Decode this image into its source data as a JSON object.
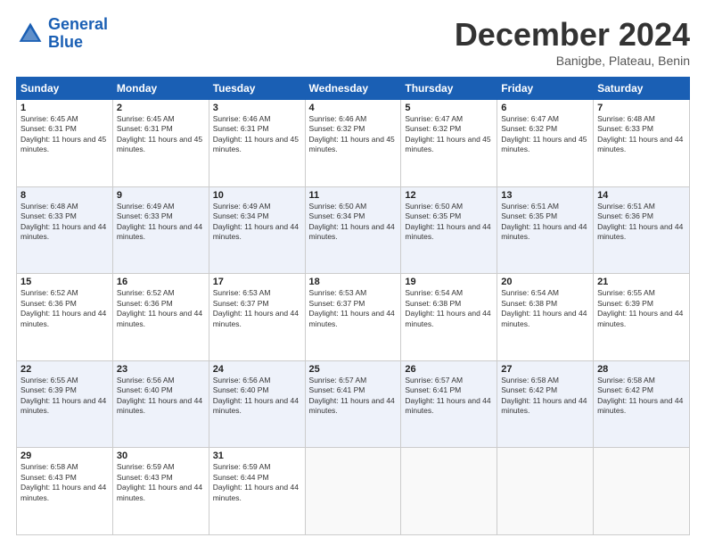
{
  "header": {
    "logo_line1": "General",
    "logo_line2": "Blue",
    "month": "December 2024",
    "location": "Banigbe, Plateau, Benin"
  },
  "days_of_week": [
    "Sunday",
    "Monday",
    "Tuesday",
    "Wednesday",
    "Thursday",
    "Friday",
    "Saturday"
  ],
  "weeks": [
    [
      {
        "day": 1,
        "sunrise": "6:45 AM",
        "sunset": "6:31 PM",
        "daylight": "11 hours and 45 minutes."
      },
      {
        "day": 2,
        "sunrise": "6:45 AM",
        "sunset": "6:31 PM",
        "daylight": "11 hours and 45 minutes."
      },
      {
        "day": 3,
        "sunrise": "6:46 AM",
        "sunset": "6:31 PM",
        "daylight": "11 hours and 45 minutes."
      },
      {
        "day": 4,
        "sunrise": "6:46 AM",
        "sunset": "6:32 PM",
        "daylight": "11 hours and 45 minutes."
      },
      {
        "day": 5,
        "sunrise": "6:47 AM",
        "sunset": "6:32 PM",
        "daylight": "11 hours and 45 minutes."
      },
      {
        "day": 6,
        "sunrise": "6:47 AM",
        "sunset": "6:32 PM",
        "daylight": "11 hours and 45 minutes."
      },
      {
        "day": 7,
        "sunrise": "6:48 AM",
        "sunset": "6:33 PM",
        "daylight": "11 hours and 44 minutes."
      }
    ],
    [
      {
        "day": 8,
        "sunrise": "6:48 AM",
        "sunset": "6:33 PM",
        "daylight": "11 hours and 44 minutes."
      },
      {
        "day": 9,
        "sunrise": "6:49 AM",
        "sunset": "6:33 PM",
        "daylight": "11 hours and 44 minutes."
      },
      {
        "day": 10,
        "sunrise": "6:49 AM",
        "sunset": "6:34 PM",
        "daylight": "11 hours and 44 minutes."
      },
      {
        "day": 11,
        "sunrise": "6:50 AM",
        "sunset": "6:34 PM",
        "daylight": "11 hours and 44 minutes."
      },
      {
        "day": 12,
        "sunrise": "6:50 AM",
        "sunset": "6:35 PM",
        "daylight": "11 hours and 44 minutes."
      },
      {
        "day": 13,
        "sunrise": "6:51 AM",
        "sunset": "6:35 PM",
        "daylight": "11 hours and 44 minutes."
      },
      {
        "day": 14,
        "sunrise": "6:51 AM",
        "sunset": "6:36 PM",
        "daylight": "11 hours and 44 minutes."
      }
    ],
    [
      {
        "day": 15,
        "sunrise": "6:52 AM",
        "sunset": "6:36 PM",
        "daylight": "11 hours and 44 minutes."
      },
      {
        "day": 16,
        "sunrise": "6:52 AM",
        "sunset": "6:36 PM",
        "daylight": "11 hours and 44 minutes."
      },
      {
        "day": 17,
        "sunrise": "6:53 AM",
        "sunset": "6:37 PM",
        "daylight": "11 hours and 44 minutes."
      },
      {
        "day": 18,
        "sunrise": "6:53 AM",
        "sunset": "6:37 PM",
        "daylight": "11 hours and 44 minutes."
      },
      {
        "day": 19,
        "sunrise": "6:54 AM",
        "sunset": "6:38 PM",
        "daylight": "11 hours and 44 minutes."
      },
      {
        "day": 20,
        "sunrise": "6:54 AM",
        "sunset": "6:38 PM",
        "daylight": "11 hours and 44 minutes."
      },
      {
        "day": 21,
        "sunrise": "6:55 AM",
        "sunset": "6:39 PM",
        "daylight": "11 hours and 44 minutes."
      }
    ],
    [
      {
        "day": 22,
        "sunrise": "6:55 AM",
        "sunset": "6:39 PM",
        "daylight": "11 hours and 44 minutes."
      },
      {
        "day": 23,
        "sunrise": "6:56 AM",
        "sunset": "6:40 PM",
        "daylight": "11 hours and 44 minutes."
      },
      {
        "day": 24,
        "sunrise": "6:56 AM",
        "sunset": "6:40 PM",
        "daylight": "11 hours and 44 minutes."
      },
      {
        "day": 25,
        "sunrise": "6:57 AM",
        "sunset": "6:41 PM",
        "daylight": "11 hours and 44 minutes."
      },
      {
        "day": 26,
        "sunrise": "6:57 AM",
        "sunset": "6:41 PM",
        "daylight": "11 hours and 44 minutes."
      },
      {
        "day": 27,
        "sunrise": "6:58 AM",
        "sunset": "6:42 PM",
        "daylight": "11 hours and 44 minutes."
      },
      {
        "day": 28,
        "sunrise": "6:58 AM",
        "sunset": "6:42 PM",
        "daylight": "11 hours and 44 minutes."
      }
    ],
    [
      {
        "day": 29,
        "sunrise": "6:58 AM",
        "sunset": "6:43 PM",
        "daylight": "11 hours and 44 minutes."
      },
      {
        "day": 30,
        "sunrise": "6:59 AM",
        "sunset": "6:43 PM",
        "daylight": "11 hours and 44 minutes."
      },
      {
        "day": 31,
        "sunrise": "6:59 AM",
        "sunset": "6:44 PM",
        "daylight": "11 hours and 44 minutes."
      },
      null,
      null,
      null,
      null
    ]
  ]
}
